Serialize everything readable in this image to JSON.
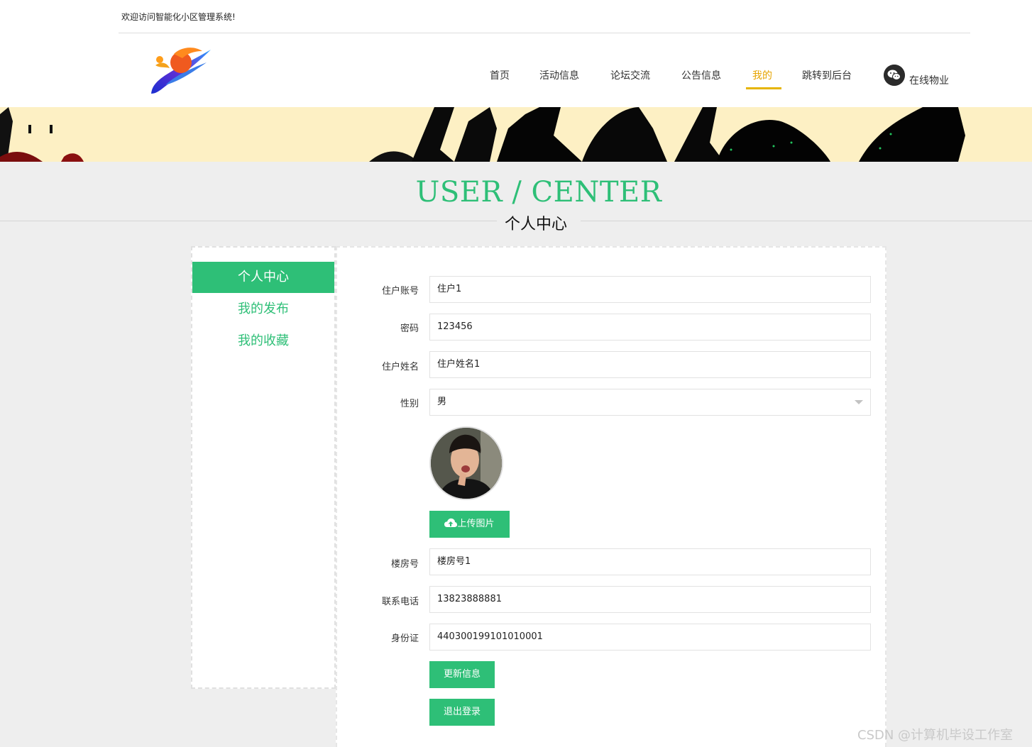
{
  "header": {
    "welcome": "欢迎访问智能化小区管理系统!",
    "nav": [
      "首页",
      "活动信息",
      "论坛交流",
      "公告信息",
      "我的",
      "跳转到后台"
    ],
    "online_service": "在线物业"
  },
  "page_title": {
    "en": "USER / CENTER",
    "cn": "个人中心"
  },
  "sidebar": {
    "items": [
      "个人中心",
      "我的发布",
      "我的收藏"
    ]
  },
  "form": {
    "account_label": "住户账号",
    "account_value": "住户1",
    "password_label": "密码",
    "password_value": "123456",
    "name_label": "住户姓名",
    "name_value": "住户姓名1",
    "gender_label": "性别",
    "gender_value": "男",
    "upload_label": "上传图片",
    "building_label": "楼房号",
    "building_value": "楼房号1",
    "phone_label": "联系电话",
    "phone_value": "13823888881",
    "id_label": "身份证",
    "id_value": "440300199101010001",
    "update_label": "更新信息",
    "logout_label": "退出登录"
  },
  "watermark": "CSDN @计算机毕设工作室",
  "colors": {
    "accent": "#2ebf77",
    "nav_active": "#e6a400",
    "banner_bg": "#fdf0c4"
  }
}
